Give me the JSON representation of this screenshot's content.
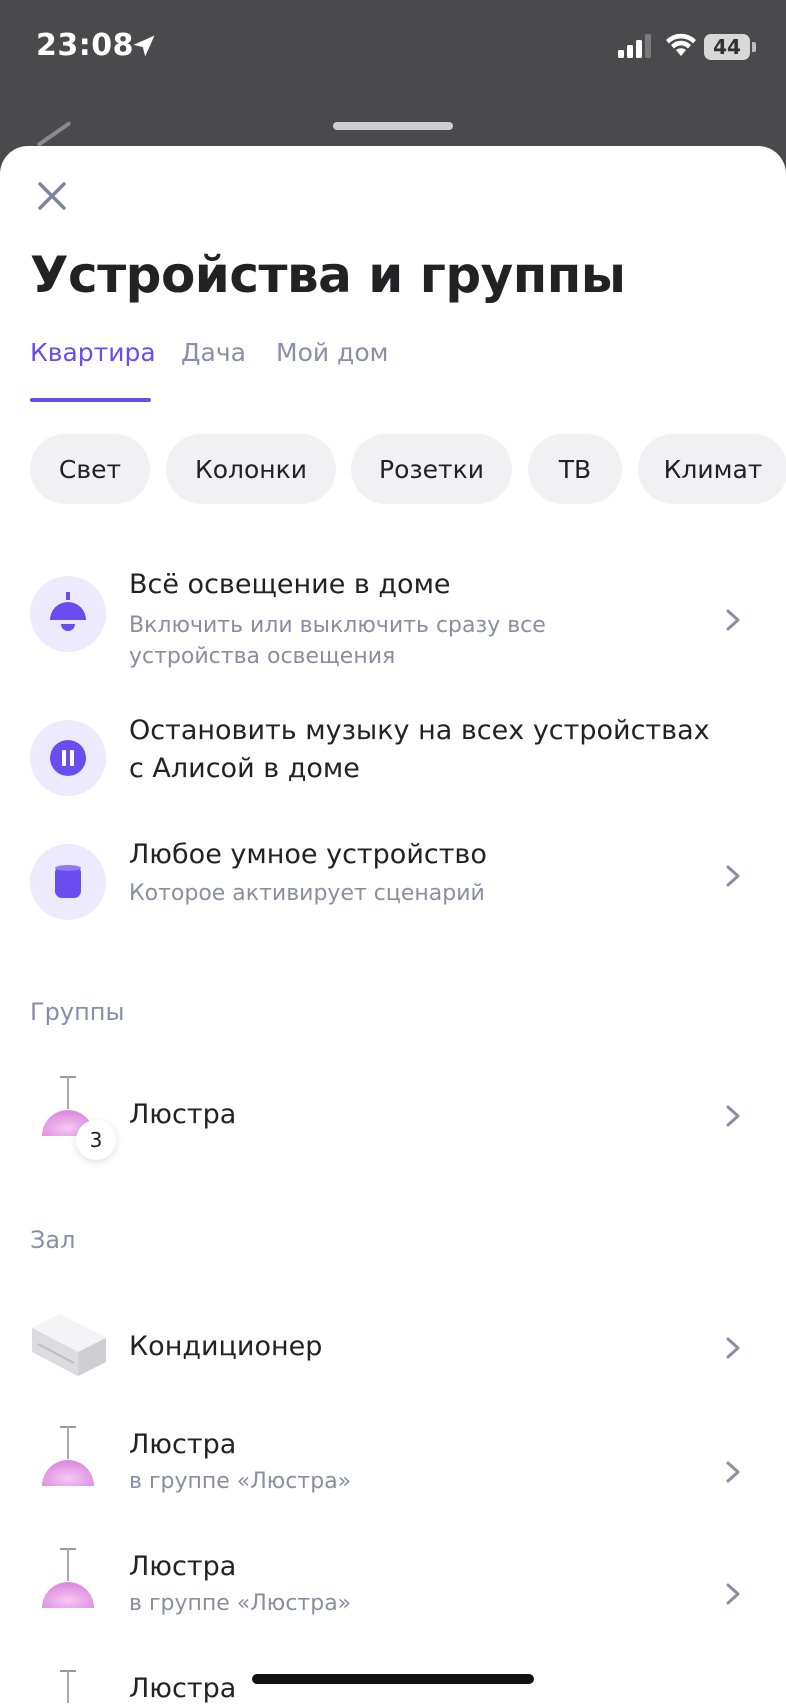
{
  "status_bar": {
    "time": "23:08",
    "battery": "44",
    "icons": [
      "location-arrow-icon",
      "cellular-signal-icon",
      "wifi-icon",
      "battery-icon"
    ]
  },
  "header": {
    "title": "Устройства и группы",
    "close_icon": "close-icon"
  },
  "tabs": [
    {
      "label": "Квартира",
      "active": true
    },
    {
      "label": "Дача",
      "active": false
    },
    {
      "label": "Мой дом",
      "active": false
    }
  ],
  "chips": [
    {
      "label": "Свет"
    },
    {
      "label": "Колонки"
    },
    {
      "label": "Розетки"
    },
    {
      "label": "ТВ"
    },
    {
      "label": "Климат"
    }
  ],
  "actions": [
    {
      "icon": "ceiling-lamp-icon",
      "title": "Всё освещение в доме",
      "subtitle_1": "Включить или выключить сразу все",
      "subtitle_2": "устройства освещения"
    },
    {
      "icon": "pause-icon",
      "title_1": "Остановить музыку на всех устройствах",
      "title_2": "с Алисой в доме"
    },
    {
      "icon": "smart-device-icon",
      "title": "Любое умное устройство",
      "subtitle": "Которое активирует сценарий"
    }
  ],
  "groups_section": {
    "label": "Группы",
    "items": [
      {
        "icon": "chandelier-icon",
        "title": "Люстра",
        "count": "3"
      }
    ]
  },
  "room_section": {
    "label": "Зал",
    "items": [
      {
        "icon": "air-conditioner-icon",
        "title": "Кондиционер"
      },
      {
        "icon": "chandelier-icon",
        "title": "Люстра",
        "subtitle": "в группе «Люстра»"
      },
      {
        "icon": "chandelier-icon",
        "title": "Люстра",
        "subtitle": "в группе «Люстра»"
      },
      {
        "icon": "chandelier-icon",
        "title": "Люстра"
      }
    ]
  },
  "colors": {
    "accent": "#6a4cf0",
    "text": "#222224",
    "muted": "#8a8fa0",
    "chip_bg": "#f1f1f4",
    "icon_bg": "#eeeafd"
  }
}
